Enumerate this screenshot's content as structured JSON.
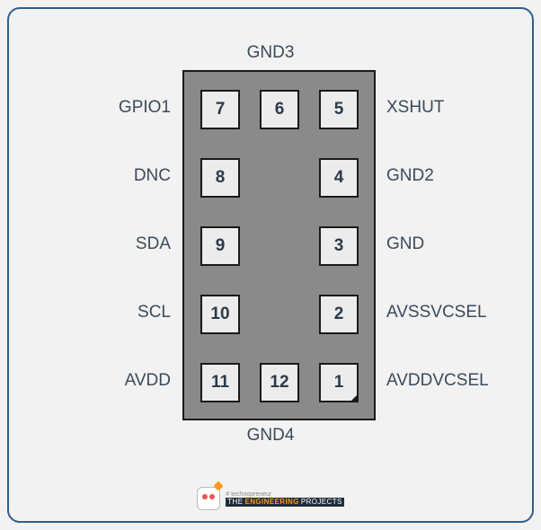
{
  "chip": {
    "top_label": "GND3",
    "bottom_label": "GND4",
    "pins": {
      "p1": {
        "num": "1",
        "label": "AVDDVCSEL",
        "side": "right"
      },
      "p2": {
        "num": "2",
        "label": "AVSSVCSEL",
        "side": "right"
      },
      "p3": {
        "num": "3",
        "label": "GND",
        "side": "right"
      },
      "p4": {
        "num": "4",
        "label": "GND2",
        "side": "right"
      },
      "p5": {
        "num": "5",
        "label": "XSHUT",
        "side": "right"
      },
      "p6": {
        "num": "6",
        "label": "",
        "side": "top"
      },
      "p7": {
        "num": "7",
        "label": "GPIO1",
        "side": "left"
      },
      "p8": {
        "num": "8",
        "label": "DNC",
        "side": "left"
      },
      "p9": {
        "num": "9",
        "label": "SDA",
        "side": "left"
      },
      "p10": {
        "num": "10",
        "label": "SCL",
        "side": "left"
      },
      "p11": {
        "num": "11",
        "label": "AVDD",
        "side": "left"
      },
      "p12": {
        "num": "12",
        "label": "",
        "side": "bottom"
      }
    }
  },
  "logo": {
    "tagline": "# technopreneur",
    "pre": "THE",
    "highlight": "ENGINEERING",
    "post": "PROJECTS"
  }
}
